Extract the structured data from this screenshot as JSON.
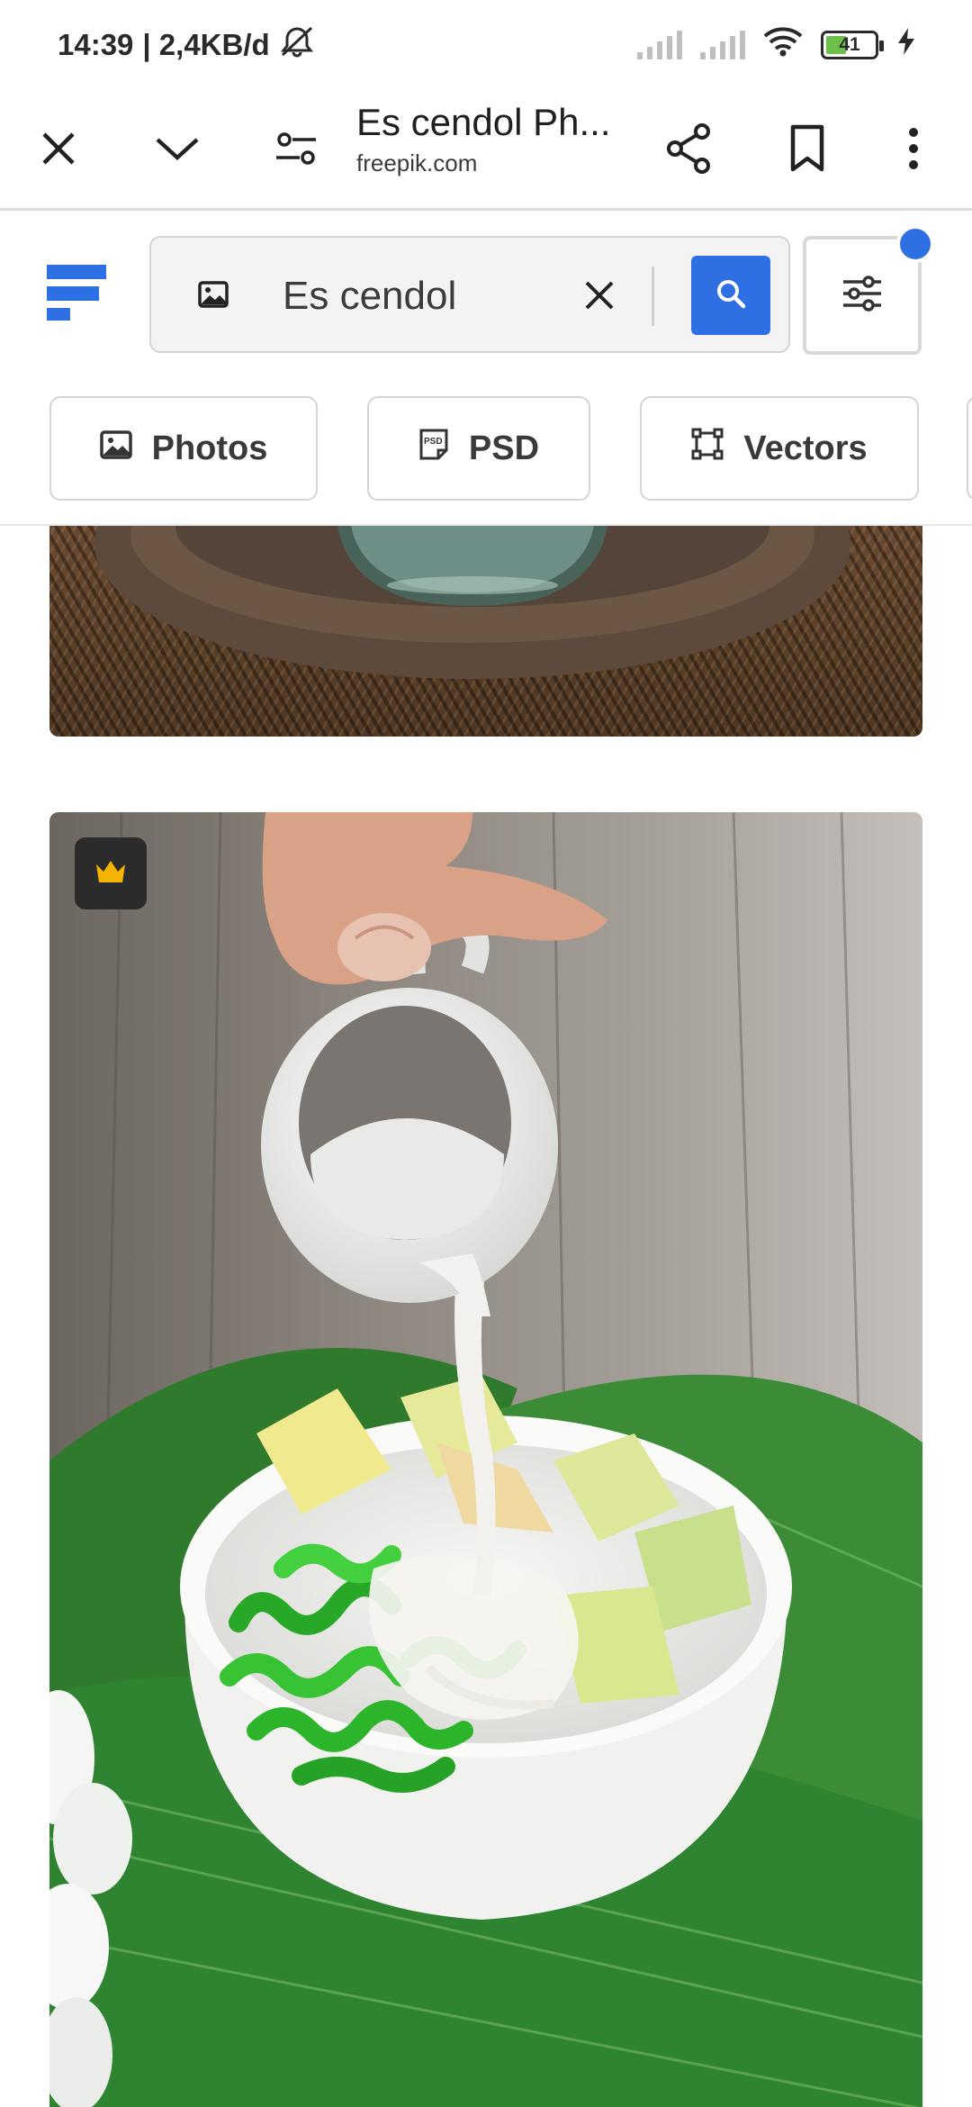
{
  "status": {
    "time": "14:39",
    "net_speed": "| 2,4KB/d",
    "battery": "41",
    "icons": [
      "alarm-off-icon",
      "signal-icon",
      "signal-icon",
      "wifi-icon",
      "battery-icon",
      "charging-icon"
    ]
  },
  "browser": {
    "title": "Es cendol Ph...",
    "url": "freepik.com",
    "icons": [
      "close-icon",
      "chevron-down-icon",
      "tune-icon",
      "share-icon",
      "bookmark-icon",
      "more-vert-icon"
    ]
  },
  "search": {
    "query": "Es cendol",
    "icons": [
      "image-icon",
      "clear-icon",
      "search-icon",
      "filter-icon"
    ]
  },
  "chips": [
    {
      "label": "Photos",
      "icon": "photo-icon"
    },
    {
      "label": "PSD",
      "icon": "psd-icon"
    },
    {
      "label": "Vectors",
      "icon": "vector-icon"
    }
  ],
  "results": {
    "badge_icon": "crown-icon",
    "colors": {
      "accent": "#2f6fe4",
      "badge_crown": "#f5b400",
      "milk": "#f6f4f1",
      "cendol_green": "#3ac23a"
    }
  }
}
